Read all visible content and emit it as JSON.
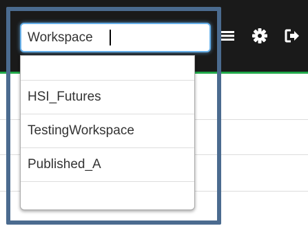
{
  "search": {
    "value": "Workspace"
  },
  "dropdown": {
    "items": [
      {
        "label": ""
      },
      {
        "label": "HSI_Futures"
      },
      {
        "label": "TestingWorkspace"
      },
      {
        "label": "Published_A"
      },
      {
        "label": ""
      }
    ]
  },
  "toolbar": {
    "icons": [
      "menu-icon",
      "gear-icon",
      "sign-out-icon"
    ]
  },
  "colors": {
    "navbar": "#1a1a1a",
    "navbar_accent": "#21a84a",
    "focus_border": "#66afe9",
    "highlight_frame": "#4b6b8f"
  }
}
